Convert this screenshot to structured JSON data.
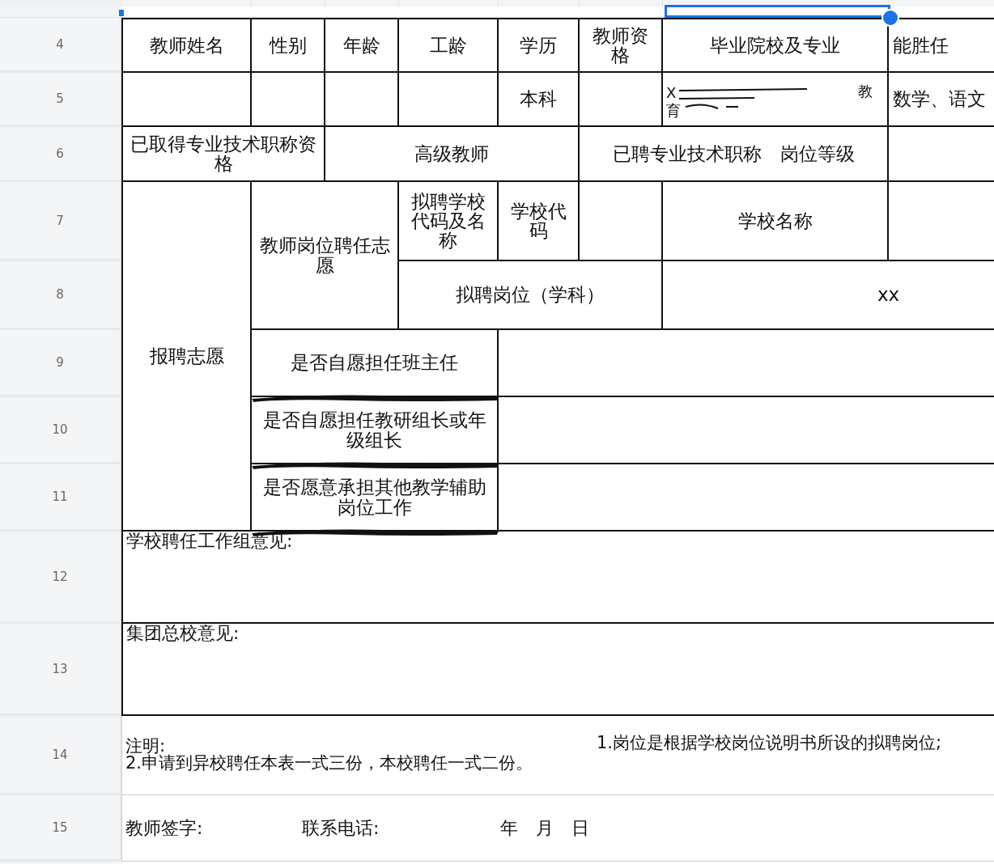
{
  "row_numbers": [
    "4",
    "5",
    "6",
    "7",
    "8",
    "9",
    "10",
    "11",
    "12",
    "13",
    "14",
    "15"
  ],
  "form_rows": [
    {
      "cells": [
        {
          "kind": "text",
          "text": "教师姓名"
        },
        {
          "kind": "text",
          "text": "性别"
        },
        {
          "kind": "text",
          "text": "年龄"
        },
        {
          "kind": "text",
          "text": "工龄"
        },
        {
          "kind": "text",
          "text": "学历"
        },
        {
          "kind": "text",
          "text": "教师资格"
        },
        {
          "kind": "text",
          "text": "毕业院校及专业"
        },
        {
          "kind": "text",
          "text": "能胜任"
        }
      ]
    },
    {
      "cells": [
        {
          "kind": "empty"
        },
        {
          "kind": "empty"
        },
        {
          "kind": "empty"
        },
        {
          "kind": "empty"
        },
        {
          "kind": "text",
          "text": "本科"
        },
        {
          "kind": "empty"
        },
        {
          "kind": "redacted",
          "fragments": [
            "X",
            "教",
            "育"
          ]
        },
        {
          "kind": "text",
          "text": "数学、语文"
        }
      ]
    },
    {
      "cells": [
        {
          "kind": "text",
          "text": "已取得专业技术职称资格"
        },
        {
          "kind": "text",
          "text": "高级教师"
        },
        {
          "kind": "text",
          "text": "已聘专业技术职称　岗位等级"
        },
        {
          "kind": "empty"
        }
      ]
    },
    {
      "cells": [
        {
          "kind": "text",
          "text": "报聘志愿"
        },
        {
          "kind": "text",
          "text": "教师岗位聘任志愿"
        },
        {
          "kind": "text",
          "text": "拟聘学校代码及名称"
        },
        {
          "kind": "text",
          "text": "学校代码"
        },
        {
          "kind": "empty"
        },
        {
          "kind": "text",
          "text": "学校名称"
        },
        {
          "kind": "empty"
        }
      ]
    },
    {
      "cells": [
        {
          "kind": "text",
          "text": "拟聘岗位（学科）"
        },
        {
          "kind": "text",
          "text": "xx"
        }
      ]
    },
    {
      "cells": [
        {
          "kind": "text",
          "text": "是否自愿担任班主任",
          "scribbled": true
        },
        {
          "kind": "empty"
        }
      ]
    },
    {
      "cells": [
        {
          "kind": "text",
          "text": "是否自愿担任教研组长或年级组长",
          "scribbled": true
        },
        {
          "kind": "empty"
        }
      ]
    },
    {
      "cells": [
        {
          "kind": "text",
          "text": "是否愿意承担其他教学辅助岗位工作",
          "scribbled": true
        },
        {
          "kind": "empty"
        }
      ]
    }
  ],
  "remarks": [
    {
      "label": "学校聘任工作组意见:"
    },
    {
      "label": "集团总校意见:"
    }
  ],
  "note": {
    "label": "注明:",
    "items": [
      "1.岗位是根据学校岗位说明书所设的拟聘岗位;",
      "2.申请到异校聘任本表一式三份，本校聘任一式二份。"
    ]
  },
  "signature": {
    "fields": [
      "教师签字:",
      "联系电话:"
    ],
    "date_parts": [
      "年",
      "月",
      "日"
    ]
  }
}
